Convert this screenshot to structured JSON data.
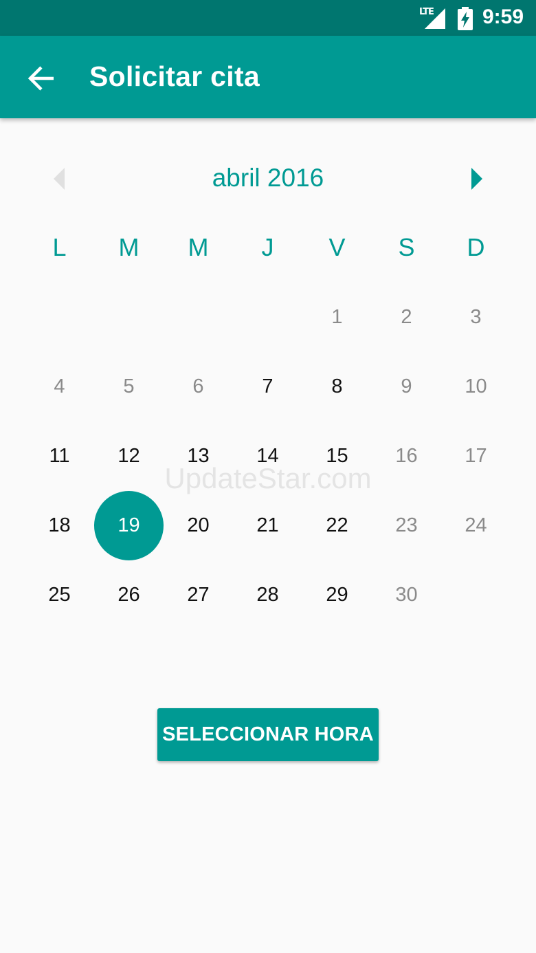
{
  "status_bar": {
    "network": "LTE",
    "time": "9:59",
    "signal_icon": "signal-icon",
    "battery_icon": "battery-charging-icon"
  },
  "app_bar": {
    "title": "Solicitar cita",
    "back_icon": "arrow-back-icon"
  },
  "calendar": {
    "month_label": "abril 2016",
    "prev_icon": "chevron-left-icon",
    "next_icon": "chevron-right-icon",
    "weekdays": [
      "L",
      "M",
      "M",
      "J",
      "V",
      "S",
      "D"
    ],
    "leading_blanks": 4,
    "days": [
      {
        "n": "1",
        "muted": true
      },
      {
        "n": "2",
        "muted": true
      },
      {
        "n": "3",
        "muted": true
      },
      {
        "n": "4",
        "muted": true
      },
      {
        "n": "5",
        "muted": true
      },
      {
        "n": "6",
        "muted": true
      },
      {
        "n": "7",
        "muted": false
      },
      {
        "n": "8",
        "muted": false
      },
      {
        "n": "9",
        "muted": true
      },
      {
        "n": "10",
        "muted": true
      },
      {
        "n": "11",
        "muted": false
      },
      {
        "n": "12",
        "muted": false
      },
      {
        "n": "13",
        "muted": false
      },
      {
        "n": "14",
        "muted": false
      },
      {
        "n": "15",
        "muted": false
      },
      {
        "n": "16",
        "muted": true
      },
      {
        "n": "17",
        "muted": true
      },
      {
        "n": "18",
        "muted": false
      },
      {
        "n": "19",
        "muted": false,
        "selected": true
      },
      {
        "n": "20",
        "muted": false
      },
      {
        "n": "21",
        "muted": false
      },
      {
        "n": "22",
        "muted": false
      },
      {
        "n": "23",
        "muted": true
      },
      {
        "n": "24",
        "muted": true
      },
      {
        "n": "25",
        "muted": false
      },
      {
        "n": "26",
        "muted": false
      },
      {
        "n": "27",
        "muted": false
      },
      {
        "n": "28",
        "muted": false
      },
      {
        "n": "29",
        "muted": false
      },
      {
        "n": "30",
        "muted": true
      }
    ]
  },
  "watermark": "UpdateStar.com",
  "action_button": {
    "label": "SELECCIONAR HORA"
  },
  "colors": {
    "primary": "#009a93",
    "primary_dark": "#00766f",
    "text": "#111111",
    "muted_text": "#8a8a8a",
    "background": "#fafafa"
  }
}
